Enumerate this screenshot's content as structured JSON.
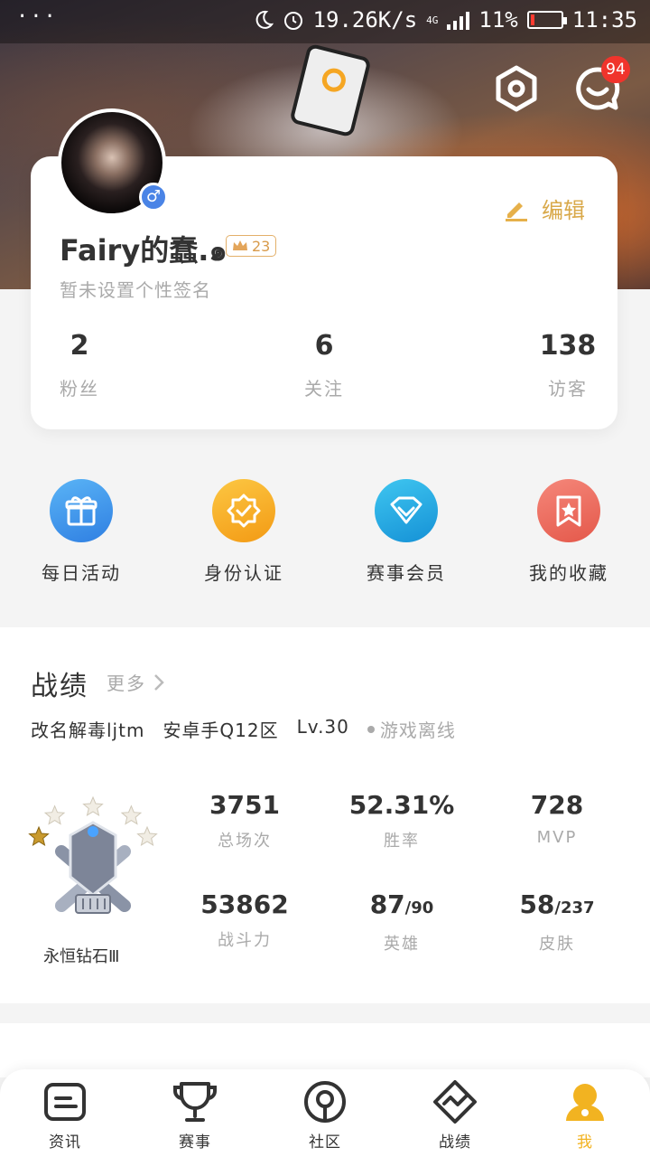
{
  "status_bar": {
    "menu": "···",
    "speed": "19.26K/s",
    "network": "4G",
    "battery": "11%",
    "battery_level": 0.11,
    "time": "11:35"
  },
  "header": {
    "message_badge": "94"
  },
  "profile": {
    "nickname": "Fairy的蠢.๑",
    "level": "23",
    "signature": "暂未设置个性签名",
    "edit_label": "编辑",
    "stats": [
      {
        "value": "2",
        "label": "粉丝"
      },
      {
        "value": "6",
        "label": "关注"
      },
      {
        "value": "138",
        "label": "访客"
      }
    ]
  },
  "quick_actions": [
    {
      "label": "每日活动",
      "icon": "gift-icon",
      "color": "#3f92ea"
    },
    {
      "label": "身份认证",
      "icon": "verify-badge-icon",
      "color": "#f6ad22"
    },
    {
      "label": "赛事会员",
      "icon": "diamond-icon",
      "color": "#1fa0dd"
    },
    {
      "label": "我的收藏",
      "icon": "bookmark-star-icon",
      "color": "#ea6a55"
    }
  ],
  "record": {
    "title": "战绩",
    "more": "更多",
    "player_name": "改名解毒ljtm",
    "server": "安卓手Q12区",
    "level": "Lv.30",
    "game_status": "游戏离线",
    "rank": "永恒钻石Ⅲ",
    "rank_stars": 1,
    "rank_stars_total": 5,
    "metrics": [
      {
        "value": "3751",
        "total": "",
        "label": "总场次"
      },
      {
        "value": "52.31%",
        "total": "",
        "label": "胜率"
      },
      {
        "value": "728",
        "total": "",
        "label": "MVP"
      },
      {
        "value": "53862",
        "total": "",
        "label": "战斗力"
      },
      {
        "value": "87",
        "total": "/90",
        "label": "英雄"
      },
      {
        "value": "58",
        "total": "/237",
        "label": "皮肤"
      }
    ]
  },
  "bottom_nav": [
    {
      "label": "资讯",
      "icon": "news-icon"
    },
    {
      "label": "赛事",
      "icon": "trophy-icon"
    },
    {
      "label": "社区",
      "icon": "community-icon"
    },
    {
      "label": "战绩",
      "icon": "stats-icon"
    },
    {
      "label": "我",
      "icon": "me-icon",
      "active": true
    }
  ],
  "colors": {
    "accent": "#f2b321",
    "edit": "#d9a94a",
    "badge": "#f0342c",
    "gender": "#4a84e6"
  }
}
